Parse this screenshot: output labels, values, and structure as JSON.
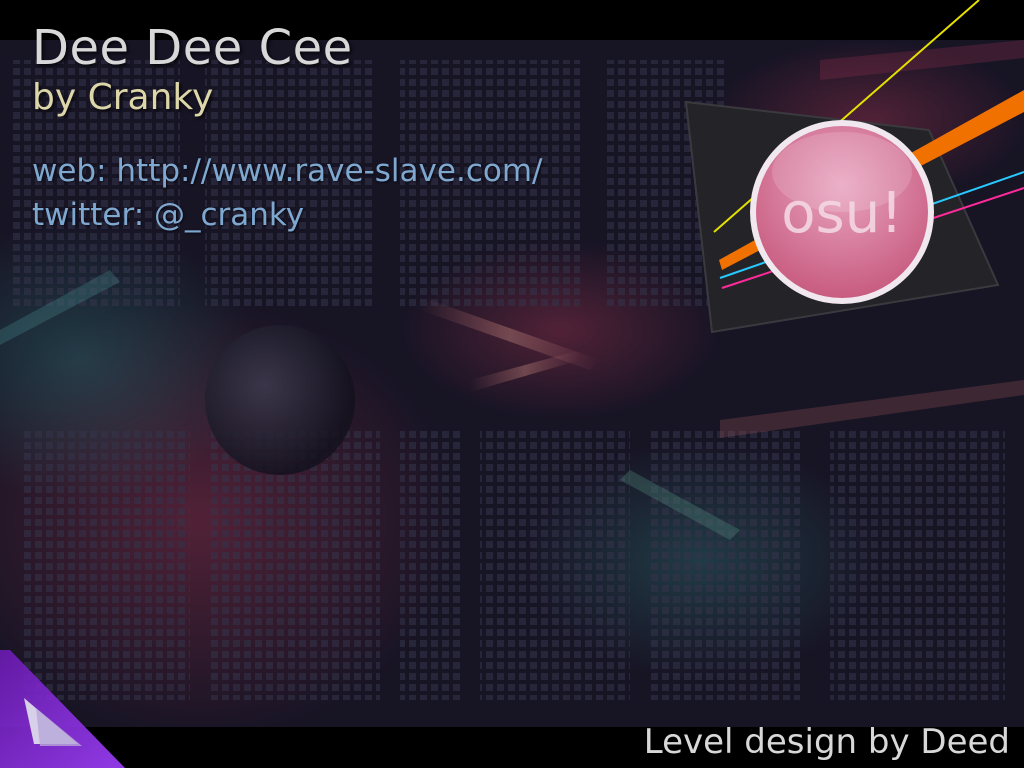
{
  "song": {
    "title": "Dee Dee Cee",
    "artist_line": "by Cranky"
  },
  "links": {
    "web": "web: http://www.rave-slave.com/",
    "twitter": "twitter: @_cranky"
  },
  "footer": {
    "credit": "Level design by Deed"
  },
  "logo": {
    "text": "osu!",
    "circle_color": "#d9839f",
    "stripe_colors": [
      "#f07000",
      "#28c8ff",
      "#ff2a9a",
      "#e6e000"
    ]
  },
  "background": {
    "base_color": "#1c1a2e",
    "led_color": "#3a3a5a",
    "accent_color": "#8a2cd8"
  }
}
